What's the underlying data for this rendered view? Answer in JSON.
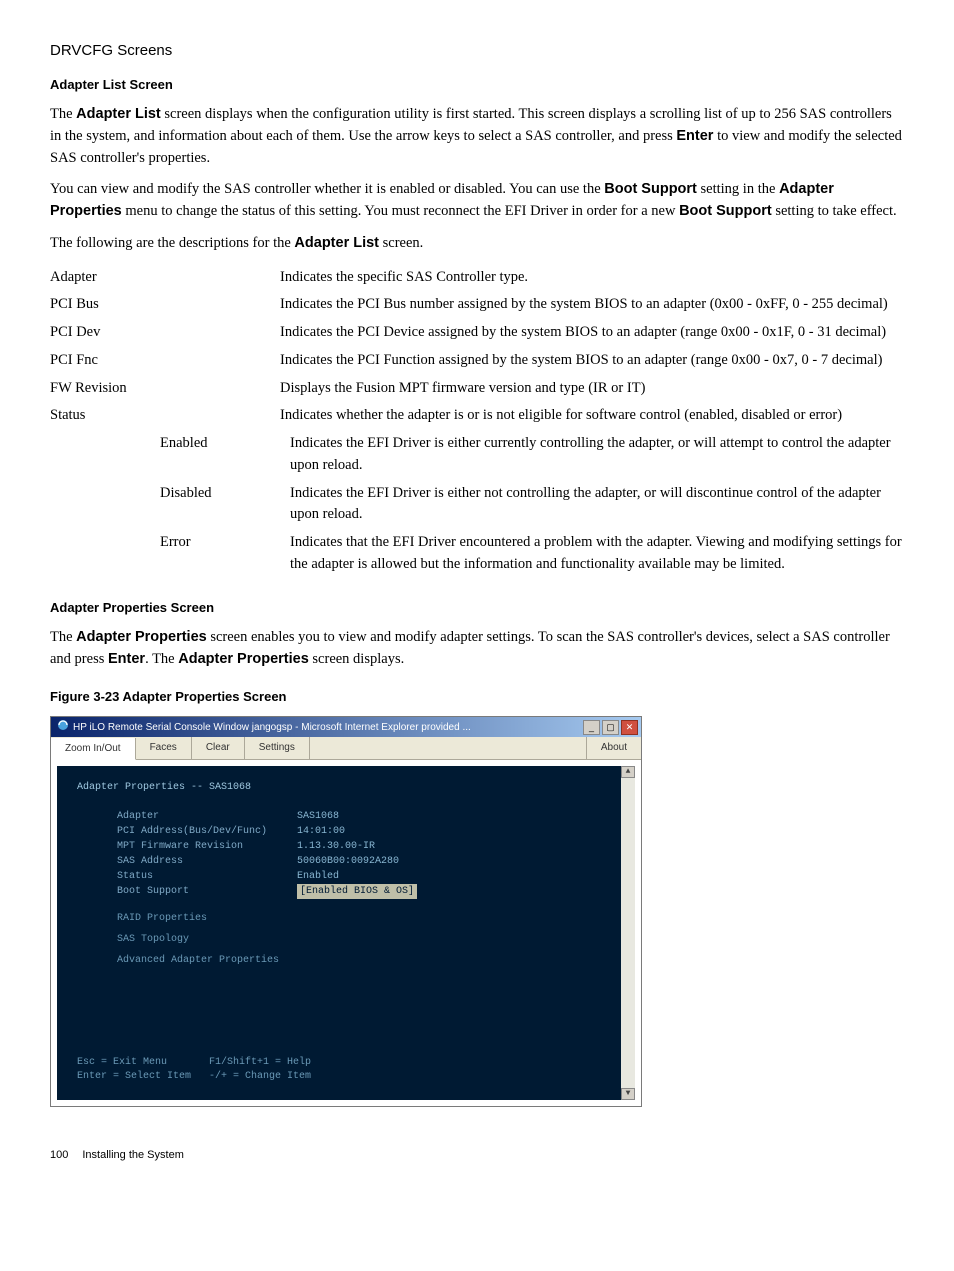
{
  "header": "DRVCFG Screens",
  "adapterList": {
    "title": "Adapter List Screen",
    "p1_pre": "The ",
    "p1_b1": "Adapter List",
    "p1_mid1": " screen displays when the configuration utility is first started. This screen displays a scrolling list of up to 256 SAS controllers in the system, and information about each of them. Use the arrow keys to select a SAS controller, and press ",
    "p1_b2": "Enter",
    "p1_tail": " to view and modify the selected SAS controller's properties.",
    "p2_pre": "You can view and modify the SAS controller whether it is enabled or disabled. You can use the ",
    "p2_b1": "Boot Support",
    "p2_mid1": " setting in the ",
    "p2_b2": "Adapter Properties",
    "p2_mid2": " menu to change the status of this setting. You must reconnect the EFI Driver in order for a new ",
    "p2_b3": "Boot Support",
    "p2_tail": " setting to take effect.",
    "p3_pre": "The following are the descriptions for the ",
    "p3_b1": "Adapter List",
    "p3_tail": " screen.",
    "defs": [
      {
        "term": "Adapter",
        "def": "Indicates the specific SAS Controller type."
      },
      {
        "term": "PCI Bus",
        "def": "Indicates the PCI Bus number assigned by the system BIOS to an adapter (0x00 - 0xFF, 0 - 255 decimal)"
      },
      {
        "term": "PCI Dev",
        "def": "Indicates the PCI Device assigned by the system BIOS to an adapter (range 0x00 - 0x1F, 0 - 31 decimal)"
      },
      {
        "term": "PCI Fnc",
        "def": "Indicates the PCI Function assigned by the system BIOS to an adapter (range 0x00 - 0x7, 0 - 7 decimal)"
      },
      {
        "term": "FW Revision",
        "def": "Displays the Fusion MPT firmware version and type (IR or IT)"
      },
      {
        "term": "Status",
        "def": "Indicates whether the adapter is or is not eligible for software control (enabled, disabled or error)"
      }
    ],
    "statusStates": [
      {
        "term": "Enabled",
        "def": "Indicates the EFI Driver is either currently controlling the adapter, or will attempt to control the adapter upon reload."
      },
      {
        "term": "Disabled",
        "def": "Indicates the EFI Driver is either not controlling the adapter, or will discontinue control of the adapter upon reload."
      },
      {
        "term": "Error",
        "def": "Indicates that the EFI Driver encountered a problem with the adapter. Viewing and modifying settings for the adapter is allowed but the information and functionality available may be limited."
      }
    ]
  },
  "adapterProps": {
    "title": "Adapter Properties Screen",
    "p1_pre": "The ",
    "p1_b1": "Adapter Properties",
    "p1_mid1": " screen enables you to view and modify adapter settings. To scan the SAS controller's devices, select a SAS controller and press ",
    "p1_b2": "Enter",
    "p1_mid2": ". The ",
    "p1_b3": "Adapter Properties",
    "p1_tail": " screen displays."
  },
  "figure": {
    "caption": "Figure 3-23 Adapter Properties Screen",
    "windowTitle": "HP iLO Remote Serial Console Window jangogsp - Microsoft Internet Explorer provided ...",
    "tabs": {
      "zoom": "Zoom In/Out",
      "faces": "Faces",
      "clear": "Clear",
      "settings": "Settings",
      "about": "About"
    },
    "consoleTitle": "Adapter Properties -- SAS1068",
    "rows": [
      {
        "lbl": "Adapter",
        "val": "SAS1068"
      },
      {
        "lbl": "PCI Address(Bus/Dev/Func)",
        "val": "14:01:00"
      },
      {
        "lbl": "MPT Firmware Revision",
        "val": "1.13.30.00-IR"
      },
      {
        "lbl": "SAS Address",
        "val": "50060B00:0092A280"
      },
      {
        "lbl": "Status",
        "val": "Enabled"
      },
      {
        "lbl": "Boot Support",
        "val": "[Enabled BIOS & OS]"
      }
    ],
    "links": [
      "RAID Properties",
      "SAS Topology",
      "Advanced Adapter Properties"
    ],
    "footer1": "Esc = Exit Menu       F1/Shift+1 = Help",
    "footer2": "Enter = Select Item   -/+ = Change Item"
  },
  "pageFooter": {
    "num": "100",
    "title": "Installing the System"
  }
}
